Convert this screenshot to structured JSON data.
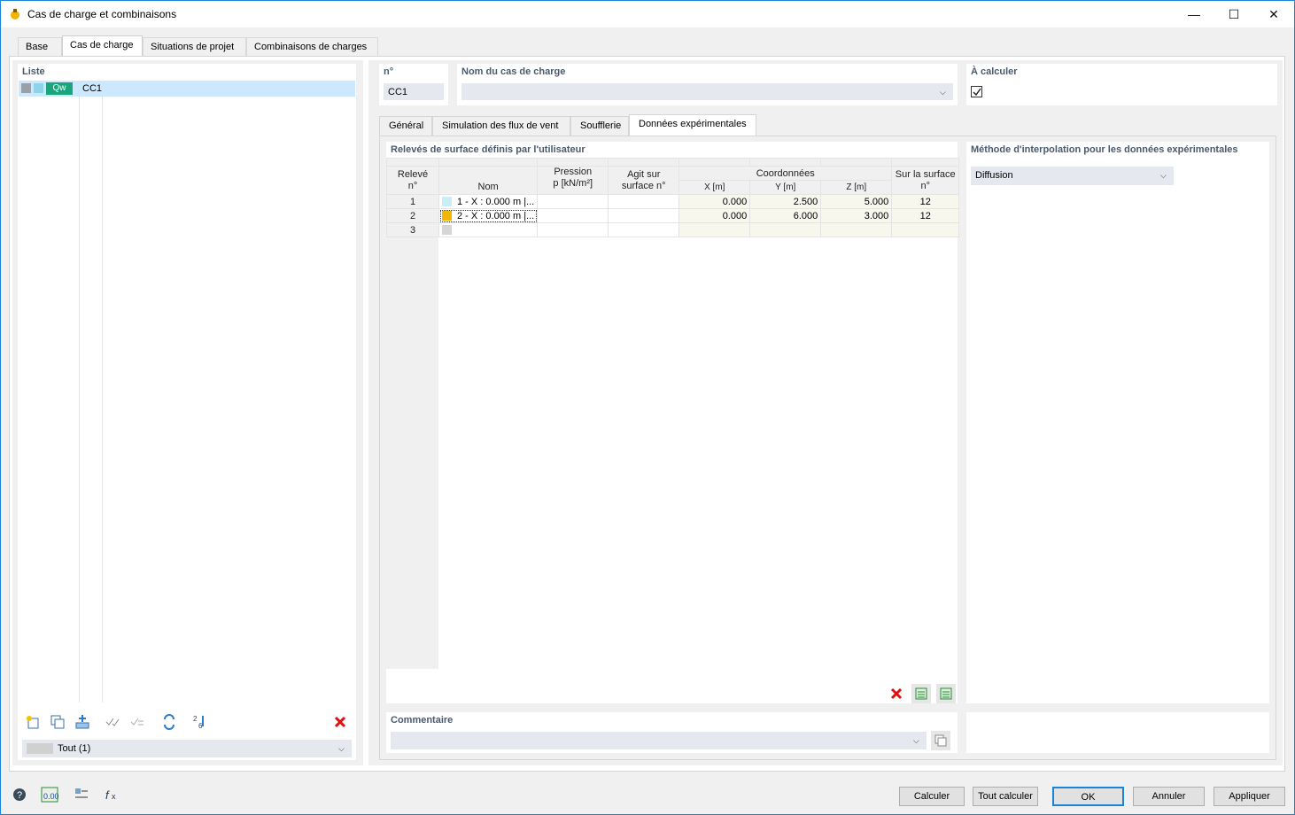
{
  "window": {
    "title": "Cas de charge et combinaisons",
    "minimize": "—",
    "maximize": "☐",
    "close": "✕"
  },
  "top_tabs": [
    {
      "label": "Base"
    },
    {
      "label": "Cas de charge"
    },
    {
      "label": "Situations de projet"
    },
    {
      "label": "Combinaisons de charges"
    }
  ],
  "list": {
    "header": "Liste",
    "items": [
      {
        "badge": "Qw",
        "name": "CC1"
      }
    ],
    "filter_value": "Tout (1)"
  },
  "header_fields": {
    "no_label": "n°",
    "no_value": "CC1",
    "name_label": "Nom du cas de charge",
    "name_value": "",
    "calc_label": "À calculer"
  },
  "sub_tabs": [
    {
      "label": "Général"
    },
    {
      "label": "Simulation des flux de vent"
    },
    {
      "label": "Soufflerie"
    },
    {
      "label": "Données expérimentales"
    }
  ],
  "surveys": {
    "title": "Relevés de surface définis par l'utilisateur",
    "headers": {
      "no_line1": "Relevé",
      "no_line2": "n°",
      "name": "Nom",
      "pressure_line1": "Pression",
      "pressure_line2": "p [kN/m²]",
      "acts_line1": "Agit sur",
      "acts_line2": "surface n°",
      "coords": "Coordonnées",
      "x": "X [m]",
      "y": "Y [m]",
      "z": "Z [m]",
      "surface_line1": "Sur la surface",
      "surface_line2": "n°"
    },
    "rows": [
      {
        "no": "1",
        "name": "1 - X : 0.000 m |...",
        "color": "#c9eef5",
        "pressure": "",
        "acts": "",
        "x": "0.000",
        "y": "2.500",
        "z": "5.000",
        "surface": "12"
      },
      {
        "no": "2",
        "name": "2 - X : 0.000 m |...",
        "color": "#f2b705",
        "pressure": "",
        "acts": "",
        "x": "0.000",
        "y": "6.000",
        "z": "3.000",
        "surface": "12"
      },
      {
        "no": "3",
        "name": "",
        "color": "#d6d6d6",
        "pressure": "",
        "acts": "",
        "x": "",
        "y": "",
        "z": "",
        "surface": ""
      }
    ]
  },
  "interpolation": {
    "label": "Méthode d'interpolation pour les données expérimentales",
    "value": "Diffusion"
  },
  "comment": {
    "label": "Commentaire",
    "value": ""
  },
  "buttons": {
    "calculate": "Calculer",
    "calculate_all": "Tout calculer",
    "ok": "OK",
    "cancel": "Annuler",
    "apply": "Appliquer"
  },
  "colors": {
    "accent": "#1883d7",
    "badge": "#1aa57a",
    "selection": "#cce8ff",
    "delete": "#e01010"
  }
}
